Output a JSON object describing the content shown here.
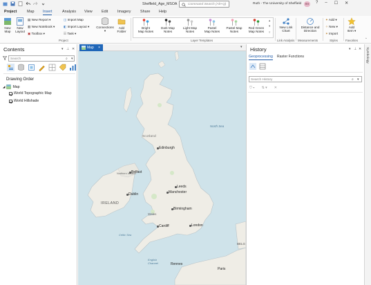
{
  "app": {
    "title": "Sheffield_Age_MSOA",
    "command_search_placeholder": "Command Search (Alt+Q)",
    "user": "Ruth - The University of Sheffield",
    "avatar_initials": "RH",
    "window_buttons": [
      "?",
      "–",
      "☐",
      "✕"
    ]
  },
  "ribbon_tabs": [
    "Project",
    "Map",
    "Insert",
    "Analysis",
    "View",
    "Edit",
    "Imagery",
    "Share",
    "Help"
  ],
  "active_tab": "Insert",
  "ribbon": {
    "project": {
      "new_map": "New Map",
      "new_layout": "New Layout",
      "new_report": "New Report",
      "new_notebook": "New Notebook",
      "toolbox": "Toolbox",
      "import_map": "Import Map",
      "import_layout": "Import Layout",
      "task": "Task",
      "connections": "Connections",
      "add_folder": "Add Folder",
      "group_label": "Project"
    },
    "layer_templates": {
      "items": [
        {
          "line1": "Bright",
          "line2": "Map Notes"
        },
        {
          "line1": "Dark Map",
          "line2": "Notes"
        },
        {
          "line1": "Light Map",
          "line2": "Notes"
        },
        {
          "line1": "Pastel",
          "line2": "Map Notes"
        },
        {
          "line1": "Pastel Map",
          "line2": "Notes"
        },
        {
          "line1": "Red Green",
          "line2": "Map Notes"
        }
      ],
      "group_label": "Layer Templates"
    },
    "link_analysis": {
      "line1": "New Link",
      "line2": "Chart",
      "group_label": "Link Analysis"
    },
    "measurements": {
      "line1": "Distance and",
      "line2": "Direction",
      "group_label": "Measurements"
    },
    "styles": {
      "add": "Add",
      "new": "New",
      "import": "Import",
      "group_label": "Styles"
    },
    "favorites": {
      "line1": "Add",
      "line2": "Item",
      "group_label": "Favorites"
    }
  },
  "contents": {
    "title": "Contents",
    "search_placeholder": "Search",
    "drawing_order": "Drawing Order",
    "map_name": "Map",
    "layers": [
      {
        "name": "World Topographic Map",
        "checked": true
      },
      {
        "name": "World Hillshade",
        "checked": true
      }
    ]
  },
  "map_view": {
    "tab_label": "Map",
    "close": "×",
    "labels": {
      "north_sea": "North Sea",
      "scotland": "Scotland",
      "edinburgh": "Edinburgh",
      "northern_ireland": "Northern Ireland",
      "belfast": "Belfast",
      "ireland": "IRELAND",
      "dublin": "Dublin",
      "leeds": "Leeds",
      "manchester": "Manchester",
      "birmingham": "Birmingham",
      "wales": "Wales",
      "cardiff": "Cardiff",
      "london": "London",
      "celtic_sea": "Celtic Sea",
      "english_channel": "English Channel",
      "rennes": "Rennes",
      "paris": "Paris",
      "belgium": "BELG"
    }
  },
  "history": {
    "title": "History",
    "tabs": [
      "Geoprocessing",
      "Raster Functions"
    ],
    "active_tab": "Geoprocessing",
    "search_placeholder": "Search History"
  },
  "side_strip": {
    "label": "Symbology"
  }
}
